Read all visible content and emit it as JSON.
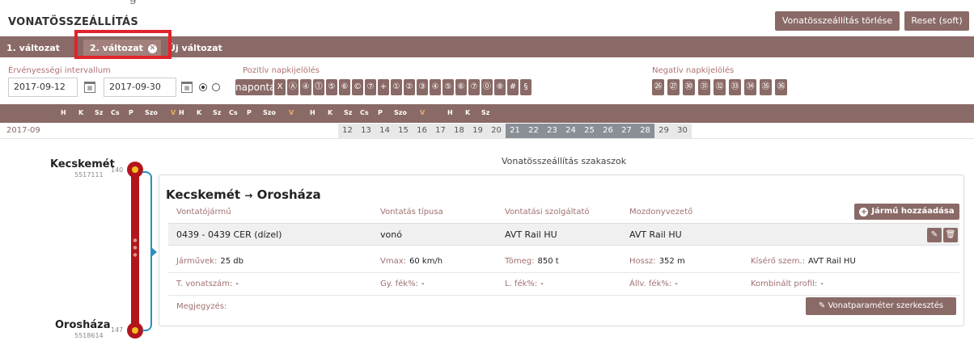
{
  "page": {
    "title": "VONATÖSSZEÁLLÍTÁS",
    "top_fragment": "g"
  },
  "header_buttons": {
    "delete": "Vonatösszeállítás törlése",
    "reset": "Reset (soft)"
  },
  "tabs": [
    {
      "label": "1. változat"
    },
    {
      "label": "2. változat"
    },
    {
      "label": "Új változat"
    }
  ],
  "validity": {
    "label": "Érvényességi intervallum",
    "from": "2017-09-12",
    "to": "2017-09-30"
  },
  "positive": {
    "label": "Pozitív napkijelölés",
    "chips": [
      "naponta",
      "X",
      "Ⓐ",
      "④",
      "⓵",
      "⑤",
      "⑥",
      "©",
      "⑦",
      "+",
      "①",
      "②",
      "③",
      "④",
      "⑤",
      "⑥",
      "⑦",
      "⓪",
      "⑧",
      "#",
      "§"
    ]
  },
  "negative": {
    "label": "Negatív napkijelölés",
    "chips": [
      "㉖",
      "㉗",
      "㉚",
      "㉛",
      "㉜",
      "㉝",
      "㉞",
      "㉟",
      "㊱"
    ]
  },
  "weekday_headers": [
    "H",
    "K",
    "Sz",
    "Cs",
    "P",
    "Szo",
    "V"
  ],
  "month": {
    "label": "2017-09",
    "days": [
      "12",
      "13",
      "14",
      "15",
      "16",
      "17",
      "18",
      "19",
      "20",
      "21",
      "22",
      "23",
      "24",
      "25",
      "26",
      "27",
      "28",
      "29",
      "30"
    ],
    "selected_from": "21",
    "selected_to": "28"
  },
  "section": {
    "title": "Vonatösszeállítás szakaszok"
  },
  "stations": {
    "start": {
      "name": "Kecskemét",
      "code": "5517111",
      "km": "140"
    },
    "end": {
      "name": "Orosháza",
      "code": "5518614",
      "km": "147"
    }
  },
  "route": {
    "from": "Kecskemét",
    "arrow": "→",
    "to": "Orosháza"
  },
  "table": {
    "headers": [
      "Vontatójármű",
      "Vontatás típusa",
      "Vontatási szolgáltató",
      "Mozdonyvezető"
    ],
    "row": [
      "0439 - 0439 CER (dízel)",
      "vonó",
      "AVT Rail HU",
      "AVT Rail HU"
    ]
  },
  "add_vehicle": "Jármű hozzáadása",
  "details": {
    "jarmuvek": {
      "k": "Járművek:",
      "v": "25 db"
    },
    "vmax": {
      "k": "Vmax:",
      "v": "60 km/h"
    },
    "tomeg": {
      "k": "Tömeg:",
      "v": "850 t"
    },
    "hossz": {
      "k": "Hossz:",
      "v": "352 m"
    },
    "kisero": {
      "k": "Kísérő szem.:",
      "v": "AVT Rail HU"
    },
    "tvonat": {
      "k": "T. vonatszám:",
      "v": "-"
    },
    "gyfek": {
      "k": "Gy. fék%:",
      "v": "-"
    },
    "lfek": {
      "k": "L. fék%:",
      "v": "-"
    },
    "allvfek": {
      "k": "Állv. fék%:",
      "v": "-"
    },
    "kombinalt": {
      "k": "Kombinált profil:",
      "v": "-"
    },
    "megjegyzes": {
      "k": "Megjegyzés:",
      "v": ""
    }
  },
  "edit_params": "Vonatparaméter szerkesztés"
}
